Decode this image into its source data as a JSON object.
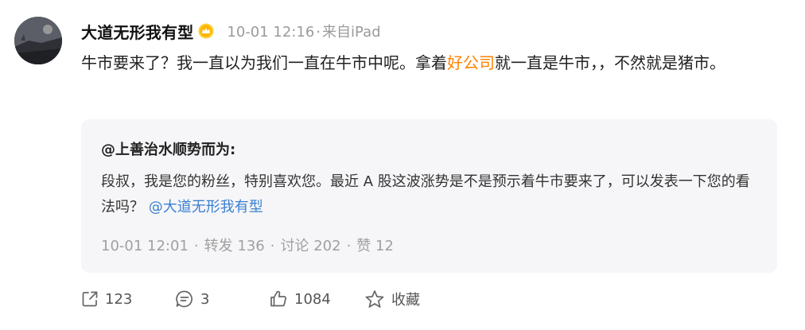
{
  "post": {
    "author": {
      "name": "大道无形我有型",
      "badge": "vip-crown-icon"
    },
    "time": "10-01 12:16",
    "source_prefix": "来自",
    "source": "iPad",
    "text_before": "牛市要来了？我一直以为我们一直在牛市中呢。拿着",
    "keyword": "好公司",
    "text_after": "就一直是牛市，，不然就是猪市。"
  },
  "repost": {
    "author": "@上善治水顺势而为",
    "author_colon": ":",
    "text": "段叔，我是您的粉丝，特别喜欢您。最近 A 股这波涨势是不是预示着牛市要来了，可以发表一下您的看法吗？",
    "mention": "@大道无形我有型",
    "time": "10-01 12:01",
    "forward_label": "转发",
    "forward_count": "136",
    "comment_label": "讨论",
    "comment_count": "202",
    "like_label": "赞",
    "like_count": "12"
  },
  "actions": {
    "forward_count": "123",
    "comment_count": "3",
    "like_count": "1084",
    "favorite_label": "收藏"
  },
  "colors": {
    "keyword": "#ff8200",
    "mention": "#3a7fd1",
    "meta": "#9a9a9a",
    "repost_bg": "#f6f6f8"
  }
}
